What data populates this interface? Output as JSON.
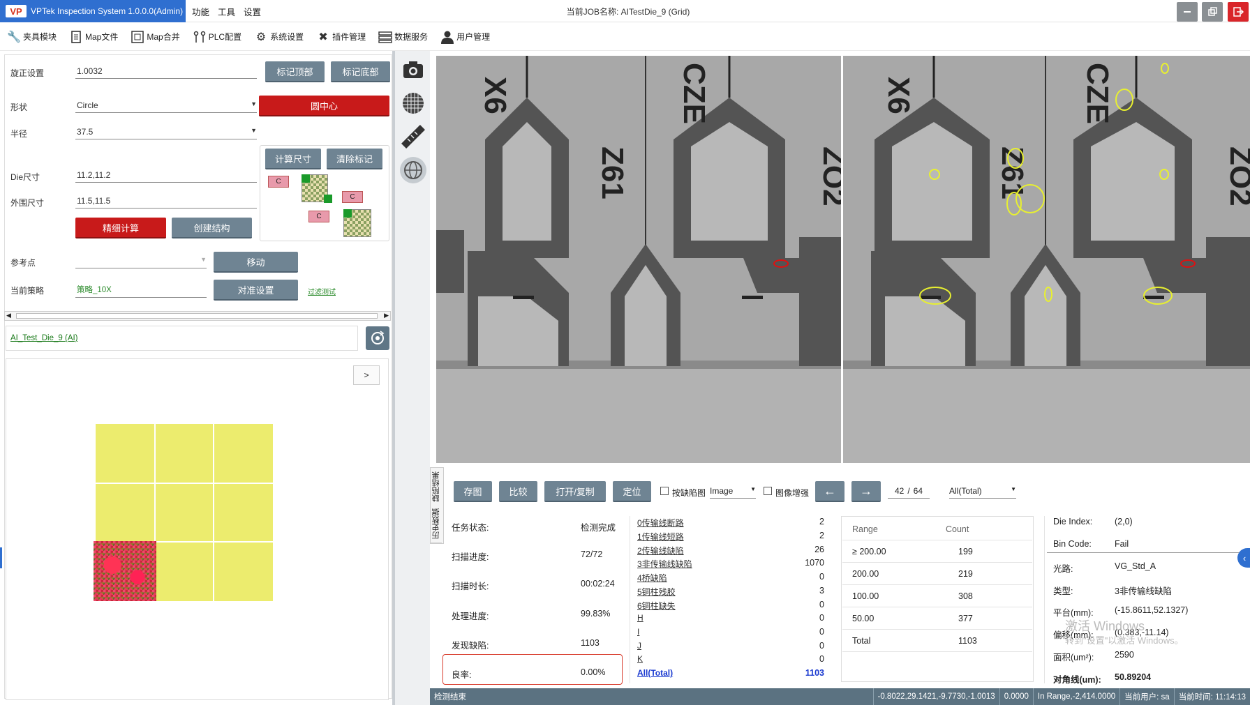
{
  "app": {
    "title": "VPTek Inspection System 1.0.0.0(Admin)",
    "logo": "VP",
    "job_title": "当前JOB名称:  AITestDie_9 (Grid)"
  },
  "menu": [
    "功能",
    "工具",
    "设置"
  ],
  "window_buttons": [
    "minimize-icon",
    "restore-icon",
    "exit-icon"
  ],
  "toolbar": [
    {
      "label": "夹具模块",
      "icon": "wrench-icon"
    },
    {
      "label": "Map文件",
      "icon": "file-icon"
    },
    {
      "label": "Map合并",
      "icon": "merge-icon"
    },
    {
      "label": "PLC配置",
      "icon": "plc-icon"
    },
    {
      "label": "系统设置",
      "icon": "gear-icon"
    },
    {
      "label": "插件管理",
      "icon": "tools-icon"
    },
    {
      "label": "数据服务",
      "icon": "database-icon"
    },
    {
      "label": "用户管理",
      "icon": "user-icon"
    }
  ],
  "left": {
    "rotation_label": "旋正设置",
    "rotation_value": "1.0032",
    "mark_top": "标记顶部",
    "mark_bottom": "标记底部",
    "shape_label": "形状",
    "shape_value": "Circle",
    "circle_center": "圆中心",
    "radius_label": "半径",
    "radius_value": "37.5",
    "calc_size": "计算尺寸",
    "clear_marks": "清除标记",
    "die_size_label": "Die尺寸",
    "die_size_value": "11.2,11.2",
    "outer_size_label": "外围尺寸",
    "outer_size_value": "11.5,11.5",
    "fine_calc": "精细计算",
    "create_struct": "创建结构",
    "ref_point_label": "参考点",
    "ref_point_value": "",
    "move": "移动",
    "strategy_label": "当前策略",
    "strategy_value": "策略_10X",
    "align_settings": "对准设置",
    "filter_test": "过滤测试",
    "job_link": "AI_Test_Die_9 (AI)",
    "expand_btn": ">",
    "diagram_marker": "C"
  },
  "sidebar_icons": [
    "camera-icon",
    "grid-icon",
    "measure-icon",
    "globe-icon"
  ],
  "images": {
    "labels_left": [
      "X6",
      "CZE",
      "Z61",
      "ZO2"
    ],
    "labels_right": [
      "X6",
      "CZE",
      "Z61",
      "ZO2"
    ]
  },
  "results": {
    "vertical_tabs": [
      "缺陷结果",
      "历史数据"
    ],
    "buttons": [
      "存图",
      "比较",
      "打开/复制",
      "定位"
    ],
    "by_defect_map": "按缺陷图",
    "image_select": "Image",
    "image_enhance": "图像增强",
    "prev": "←",
    "next": "→",
    "page_current": "42",
    "page_sep": "/",
    "page_total": "64",
    "filter": "All(Total)",
    "stats": [
      {
        "label": "任务状态:",
        "value": "检测完成"
      },
      {
        "label": "扫描进度:",
        "value": "72/72"
      },
      {
        "label": "扫描时长:",
        "value": "00:02:24"
      },
      {
        "label": "处理进度:",
        "value": "99.83%"
      },
      {
        "label": "发现缺陷:",
        "value": "1103"
      },
      {
        "label": "良率:",
        "value": "0.00%"
      }
    ],
    "defects": [
      {
        "name": "0传输线断路",
        "count": "2"
      },
      {
        "name": "1传输线短路",
        "count": "2"
      },
      {
        "name": "2传输线缺陷",
        "count": "26"
      },
      {
        "name": "3非传输线缺陷",
        "count": "1070"
      },
      {
        "name": "4桥缺陷",
        "count": "0"
      },
      {
        "name": "5铜柱残胶",
        "count": "3"
      },
      {
        "name": "6铜柱缺失",
        "count": "0"
      },
      {
        "name": "H",
        "count": "0"
      },
      {
        "name": "I",
        "count": "0"
      },
      {
        "name": "J",
        "count": "0"
      },
      {
        "name": "K",
        "count": "0"
      },
      {
        "name": "All(Total)",
        "count": "1103"
      }
    ],
    "range_table": {
      "headers": [
        "Range",
        "Count"
      ],
      "rows": [
        [
          "≥ 200.00",
          "199"
        ],
        [
          "200.00",
          "219"
        ],
        [
          "100.00",
          "308"
        ],
        [
          "50.00",
          "377"
        ],
        [
          "Total",
          "1103"
        ]
      ]
    },
    "info": [
      {
        "label": "Die Index:",
        "value": "(2,0)"
      },
      {
        "label": "Bin Code:",
        "value": "Fail"
      },
      {
        "label": "光路:",
        "value": "VG_Std_A"
      },
      {
        "label": "类型:",
        "value": "3非传输线缺陷"
      },
      {
        "label": "平台(mm):",
        "value": "(-15.8611,52.1327)"
      },
      {
        "label": "偏移(mm):",
        "value": "(0.383,-11.14)"
      },
      {
        "label": "面积(um²):",
        "value": "2590"
      },
      {
        "label": "对角线(um):",
        "value": "50.89204"
      }
    ],
    "watermark_1": "激活 Windows",
    "watermark_2": "转到\"设置\"以激活 Windows。"
  },
  "statusbar": {
    "left": "检测结束",
    "coords": "-0.8022,29.1421,-9.7730,-1.0013",
    "z": "0.0000",
    "range": "In Range,-2,414.0000",
    "user": "当前用户: sa",
    "time": "当前时间: 11:14:13"
  },
  "colors": {
    "accent": "#2f6fd0",
    "red": "#c81a1a",
    "button": "#6f8493",
    "status": "#5b7281",
    "map_yellow": "#ecec6e"
  }
}
